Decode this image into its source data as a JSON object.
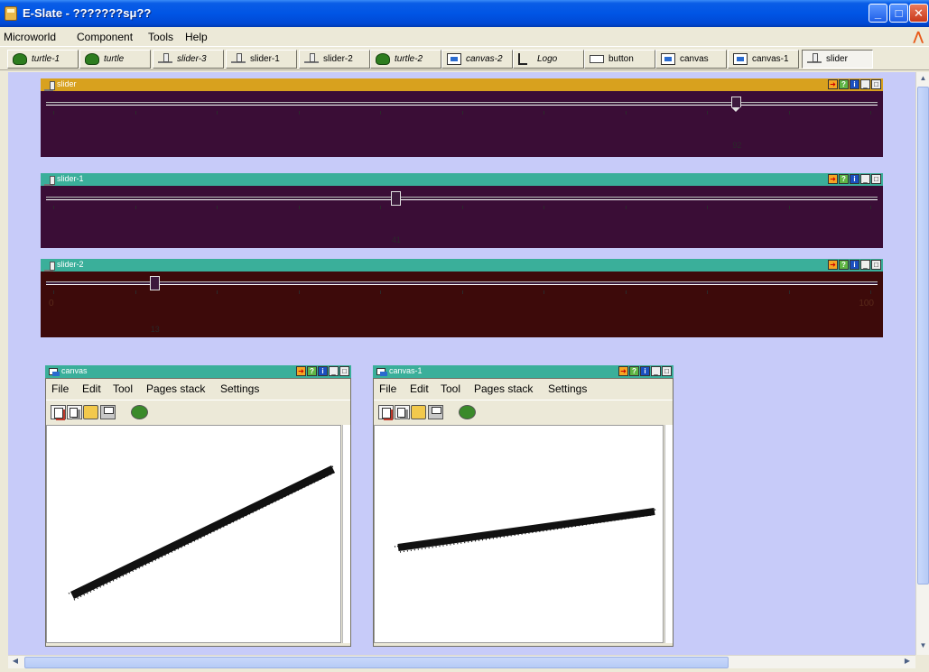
{
  "window": {
    "title": "E-Slate - ???????sμ??",
    "buttons": {
      "minimize": "_",
      "maximize": "□",
      "close": "✕"
    }
  },
  "menubar": [
    "Microworld",
    "Component",
    "Tools",
    "Help"
  ],
  "component_tabs": [
    {
      "label": "turtle-1",
      "icon": "turtle-icon",
      "italic": true,
      "active": false
    },
    {
      "label": "turtle",
      "icon": "turtle-icon",
      "italic": true,
      "active": false
    },
    {
      "label": "slider-3",
      "icon": "slider-icon",
      "italic": true,
      "active": false
    },
    {
      "label": "slider-1",
      "icon": "slider-icon",
      "italic": false,
      "active": false
    },
    {
      "label": "slider-2",
      "icon": "slider-icon",
      "italic": false,
      "active": false
    },
    {
      "label": "turtle-2",
      "icon": "turtle-icon",
      "italic": true,
      "active": false
    },
    {
      "label": "canvas-2",
      "icon": "canvas-icon",
      "italic": true,
      "active": false
    },
    {
      "label": "Logo",
      "icon": "logo-icon",
      "italic": true,
      "active": false
    },
    {
      "label": "button",
      "icon": "button-icon",
      "italic": false,
      "active": false
    },
    {
      "label": "canvas",
      "icon": "canvas-icon",
      "italic": false,
      "active": false
    },
    {
      "label": "canvas-1",
      "icon": "canvas-icon",
      "italic": false,
      "active": false
    },
    {
      "label": "slider",
      "icon": "slider-icon",
      "italic": false,
      "active": true
    }
  ],
  "frame_buttons": {
    "plug": "➜",
    "help": "?",
    "info": "i",
    "minimize": "_",
    "maximize": "□"
  },
  "sliders": [
    {
      "title": "slider",
      "value_label": "92",
      "position": 0.83,
      "color": "#3a0d36",
      "header_color": "#d8a11e",
      "end_labels": [
        "",
        ""
      ]
    },
    {
      "title": "slider-1",
      "value_label": "41",
      "position": 0.42,
      "color": "#3a0d36",
      "header_color": "#3aaf9a",
      "end_labels": [
        "",
        ""
      ]
    },
    {
      "title": "slider-2",
      "value_label": "13",
      "position": 0.13,
      "color": "#3d0a0a",
      "header_color": "#3aaf9a",
      "end_labels": [
        "0",
        "100"
      ]
    }
  ],
  "canvases": [
    {
      "title": "canvas",
      "menu": [
        "File",
        "Edit",
        "Tool",
        "Pages stack",
        "Settings"
      ]
    },
    {
      "title": "canvas-1",
      "menu": [
        "File",
        "Edit",
        "Tool",
        "Pages stack",
        "Settings"
      ]
    }
  ],
  "colors": {
    "desktop": "#c7cbf9",
    "frame_header": "#3aaf9a",
    "title_bar": "#0055e5"
  }
}
